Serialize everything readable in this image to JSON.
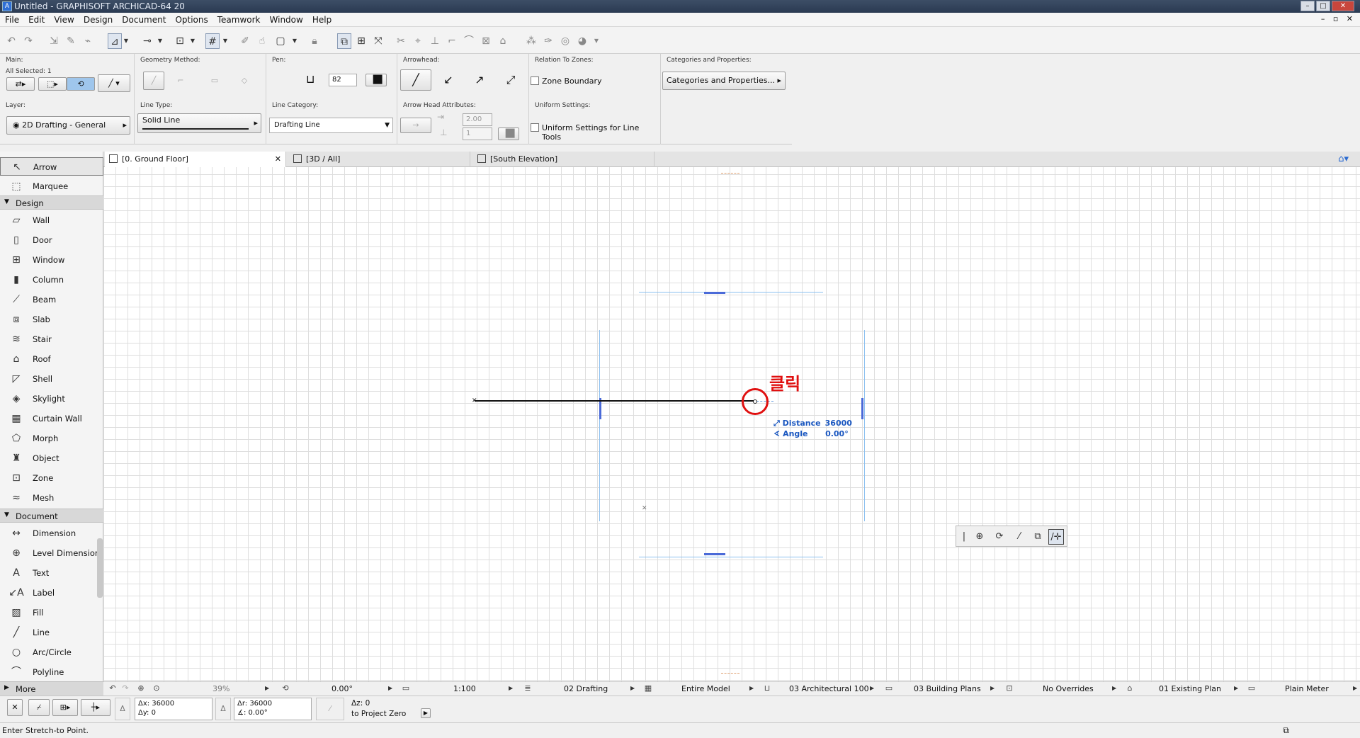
{
  "window": {
    "title": "Untitled - GRAPHISOFT ARCHICAD-64 20",
    "app_icon": "archicad-logo-icon"
  },
  "menu": [
    "File",
    "Edit",
    "View",
    "Design",
    "Document",
    "Options",
    "Teamwork",
    "Window",
    "Help"
  ],
  "info_box": {
    "main_label": "Main:",
    "all_selected": "All Selected: 1",
    "geometry_label": "Geometry Method:",
    "pen_label": "Pen:",
    "pen_value": "82",
    "arrowhead_label": "Arrowhead:",
    "zones_label": "Relation To Zones:",
    "zone_boundary": "Zone Boundary",
    "categories_label": "Categories and Properties:",
    "categories_button": "Categories and Properties...",
    "layer_label": "Layer:",
    "layer_value": "2D Drafting - General",
    "linetype_label": "Line Type:",
    "linetype_value": "Solid Line",
    "linecat_label": "Line Category:",
    "linecat_value": "Drafting Line",
    "arrowattr_label": "Arrow Head Attributes:",
    "arrow_size": "2.00",
    "arrow_pen": "1",
    "uniform_label": "Uniform Settings:",
    "uniform_check": "Uniform Settings for Line Tools"
  },
  "toolbox": {
    "top": [
      {
        "label": "Arrow",
        "icon": "arrow-icon"
      },
      {
        "label": "Marquee",
        "icon": "marquee-icon"
      }
    ],
    "design_group": "Design",
    "design": [
      {
        "label": "Wall",
        "icon": "wall-icon"
      },
      {
        "label": "Door",
        "icon": "door-icon"
      },
      {
        "label": "Window",
        "icon": "window-icon"
      },
      {
        "label": "Column",
        "icon": "column-icon"
      },
      {
        "label": "Beam",
        "icon": "beam-icon"
      },
      {
        "label": "Slab",
        "icon": "slab-icon"
      },
      {
        "label": "Stair",
        "icon": "stair-icon"
      },
      {
        "label": "Roof",
        "icon": "roof-icon"
      },
      {
        "label": "Shell",
        "icon": "shell-icon"
      },
      {
        "label": "Skylight",
        "icon": "skylight-icon"
      },
      {
        "label": "Curtain Wall",
        "icon": "curtain-wall-icon"
      },
      {
        "label": "Morph",
        "icon": "morph-icon"
      },
      {
        "label": "Object",
        "icon": "object-icon"
      },
      {
        "label": "Zone",
        "icon": "zone-icon"
      },
      {
        "label": "Mesh",
        "icon": "mesh-icon"
      }
    ],
    "document_group": "Document",
    "document": [
      {
        "label": "Dimension",
        "icon": "dimension-icon"
      },
      {
        "label": "Level Dimension",
        "icon": "level-dimension-icon"
      },
      {
        "label": "Text",
        "icon": "text-icon"
      },
      {
        "label": "Label",
        "icon": "label-icon"
      },
      {
        "label": "Fill",
        "icon": "fill-icon"
      },
      {
        "label": "Line",
        "icon": "line-icon"
      },
      {
        "label": "Arc/Circle",
        "icon": "arc-circle-icon"
      },
      {
        "label": "Polyline",
        "icon": "polyline-icon"
      }
    ],
    "more": "More"
  },
  "tabs": [
    {
      "label": "[0. Ground Floor]",
      "icon": "floor-plan-icon"
    },
    {
      "label": "[3D / All]",
      "icon": "3d-view-icon"
    },
    {
      "label": "[South Elevation]",
      "icon": "elevation-icon"
    }
  ],
  "canvas": {
    "click_text": "클릭",
    "tracker_distance_label": "Distance",
    "tracker_distance_value": "36000",
    "tracker_angle_label": "Angle",
    "tracker_angle_value": "0.00°"
  },
  "navbar": {
    "zoom": "39%",
    "rotation": "0.00°",
    "scale": "1:100",
    "layer_combo": "02 Drafting",
    "model_view": "Entire Model",
    "pen_set": "03 Architectural 100",
    "mvo": "03 Building Plans",
    "graphic_override": "No Overrides",
    "renovation": "01 Existing Plan",
    "dimension": "Plain Meter"
  },
  "coords": {
    "dx": "Δx: 36000",
    "dy": "Δy: 0",
    "dr": "Δr: 36000",
    "da": "∡: 0.00°",
    "dz": "Δz: 0",
    "ref": "to Project Zero"
  },
  "status": "Enter Stretch-to Point.",
  "colors": {
    "accent": "#1a57c0",
    "guide": "#8cc0f0",
    "click_marker": "#e01010"
  }
}
